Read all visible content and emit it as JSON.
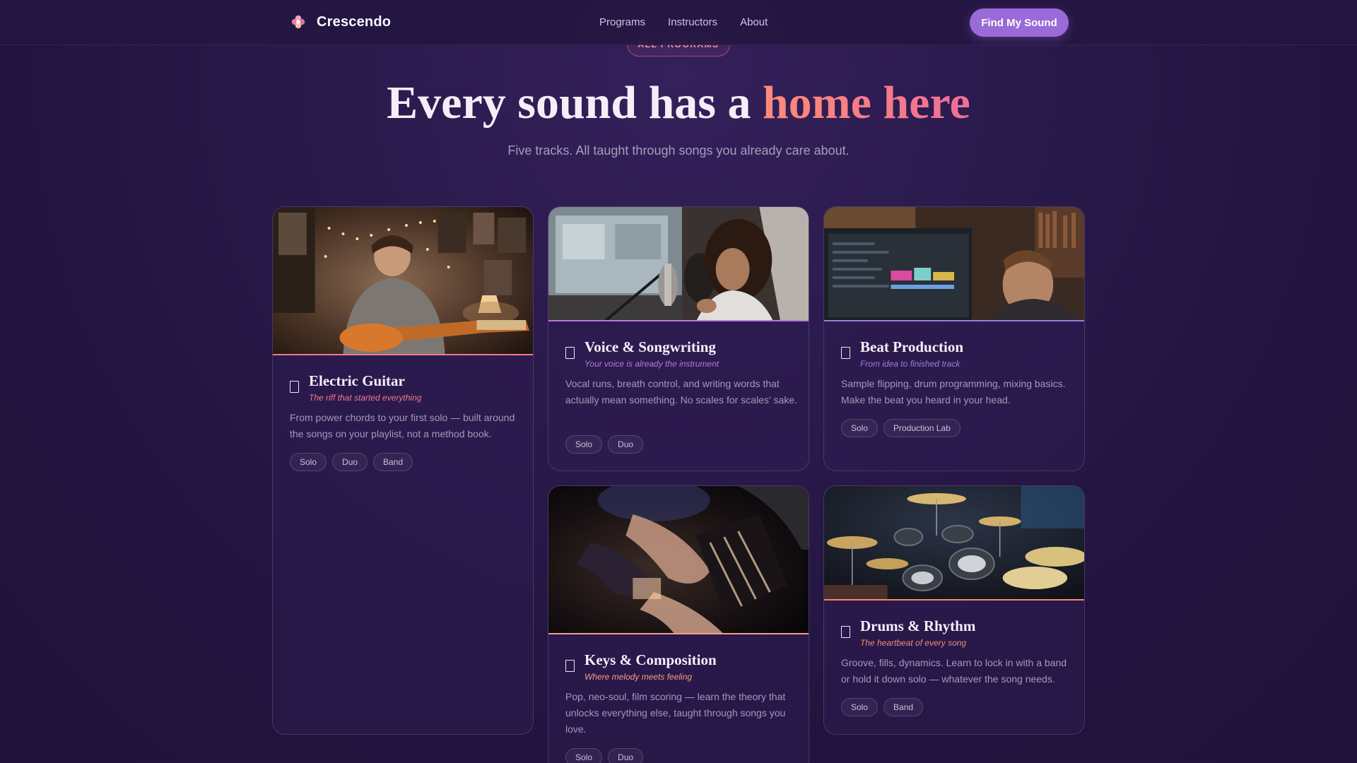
{
  "brand": {
    "name": "Crescendo"
  },
  "nav": {
    "links": [
      "Programs",
      "Instructors",
      "About"
    ],
    "cta": "Find My Sound"
  },
  "hero": {
    "eyebrow": "ALL PROGRAMS",
    "title_prefix": "Every sound has a ",
    "title_accent": "home here",
    "subtitle": "Five tracks. All taught through songs you already care about."
  },
  "colors": {
    "accent_pink": "#ef6f97",
    "accent_purple": "#9a6bd8",
    "background": "#22143f"
  },
  "programs": [
    {
      "title": "Electric Guitar",
      "tagline": "The riff that started everything",
      "tagline_color": "#f07a8c",
      "description": "From power chords to your first solo — built around the songs on your playlist, not a method book.",
      "formats": [
        "Solo",
        "Duo",
        "Band"
      ],
      "icon": "guitar-icon",
      "image": "teen playing electric guitar in bedroom"
    },
    {
      "title": "Voice & Songwriting",
      "tagline": "Your voice is already the instrument",
      "tagline_color": "#b57ad9",
      "description": "Vocal runs, breath control, and writing words that actually mean something. No scales for scales' sake.",
      "formats": [
        "Solo",
        "Duo"
      ],
      "icon": "microphone-icon",
      "image": "singer at studio microphone"
    },
    {
      "title": "Beat Production",
      "tagline": "From idea to finished track",
      "tagline_color": "#9a7fd6",
      "description": "Sample flipping, drum programming, mixing basics. Make the beat you heard in your head.",
      "formats": [
        "Solo",
        "Production Lab"
      ],
      "icon": "headphones-icon",
      "image": "producer at computer monitors"
    },
    {
      "title": "Keys & Composition",
      "tagline": "Where melody meets feeling",
      "tagline_color": "#f3a07e",
      "description": "Pop, neo-soul, film scoring — learn the theory that unlocks everything else, taught through songs you love.",
      "formats": [
        "Solo",
        "Duo"
      ],
      "icon": "piano-icon",
      "image": "hands playing piano keys"
    },
    {
      "title": "Drums & Rhythm",
      "tagline": "The heartbeat of every song",
      "tagline_color": "#f28a6e",
      "description": "Groove, fills, dynamics. Learn to lock in with a band or hold it down solo — whatever the song needs.",
      "formats": [
        "Solo",
        "Band"
      ],
      "icon": "drum-icon",
      "image": "drum kit on stage"
    }
  ]
}
